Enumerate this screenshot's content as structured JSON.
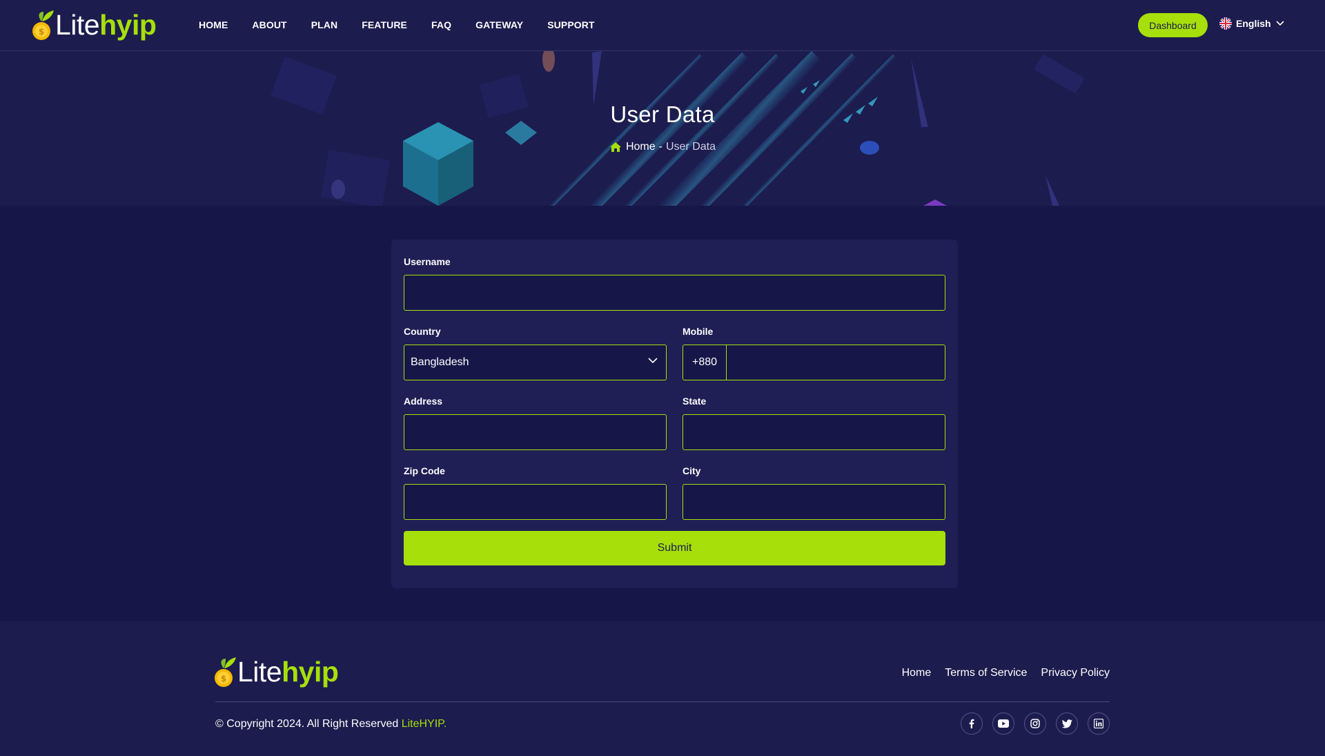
{
  "brand": {
    "name_part1": "Lite",
    "name_part2": "hyip",
    "accent_color": "#a7df0a",
    "bg_color": "#161648"
  },
  "nav": {
    "items": [
      {
        "label": "HOME"
      },
      {
        "label": "ABOUT"
      },
      {
        "label": "PLAN"
      },
      {
        "label": "FEATURE"
      },
      {
        "label": "FAQ"
      },
      {
        "label": "GATEWAY"
      },
      {
        "label": "SUPPORT"
      }
    ],
    "dashboard_label": "Dashboard",
    "language": {
      "label": "English",
      "icon": "uk-flag-icon"
    }
  },
  "banner": {
    "title": "User Data",
    "breadcrumb": {
      "home": "Home",
      "separator": "-",
      "current": "User Data"
    }
  },
  "form": {
    "username": {
      "label": "Username",
      "value": ""
    },
    "country": {
      "label": "Country",
      "value": "Bangladesh"
    },
    "mobile": {
      "label": "Mobile",
      "code": "+880",
      "value": ""
    },
    "address": {
      "label": "Address",
      "value": ""
    },
    "state": {
      "label": "State",
      "value": ""
    },
    "zip": {
      "label": "Zip Code",
      "value": ""
    },
    "city": {
      "label": "City",
      "value": ""
    },
    "submit_label": "Submit"
  },
  "footer": {
    "links": [
      {
        "label": "Home"
      },
      {
        "label": "Terms of Service"
      },
      {
        "label": "Privacy Policy"
      }
    ],
    "copyright_text": "© Copyright 2024. All Right Reserved ",
    "copyright_brand": "LiteHYIP.",
    "socials": [
      "facebook-icon",
      "youtube-icon",
      "instagram-icon",
      "twitter-icon",
      "linkedin-icon"
    ]
  }
}
